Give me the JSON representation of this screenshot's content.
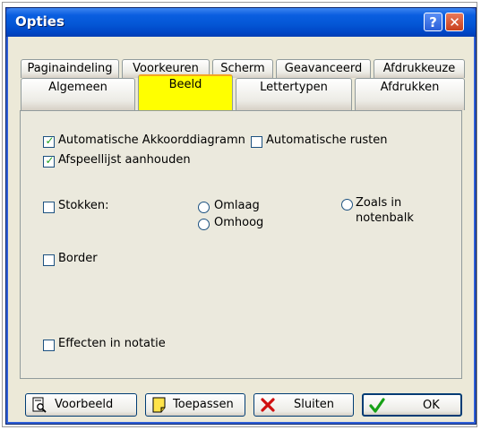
{
  "window": {
    "title": "Opties"
  },
  "titlebar": {
    "help_glyph": "?",
    "close_glyph": "✕"
  },
  "tabs": {
    "row1": [
      "Paginaindeling",
      "Voorkeuren",
      "Scherm",
      "Geavanceerd",
      "Afdrukkeuze"
    ],
    "row2": [
      "Algemeen",
      "Beeld",
      "Lettertypen",
      "Afdrukken"
    ],
    "active": "Beeld"
  },
  "options": {
    "auto_chord": {
      "label": "Automatische Akkoorddiagramn",
      "checked": true
    },
    "auto_rests": {
      "label": "Automatische rusten",
      "checked": false
    },
    "keep_playlist": {
      "label": "Afspeellijst aanhouden",
      "checked": true
    },
    "stems": {
      "label": "Stokken:",
      "checked": false
    },
    "stem_down": {
      "label": "Omlaag"
    },
    "stem_up": {
      "label": "Omhoog"
    },
    "stem_as_staff": {
      "label_line1": "Zoals in",
      "label_line2": "notenbalk"
    },
    "border": {
      "label": "Border",
      "checked": false
    },
    "effects": {
      "label": "Effecten in notatie",
      "checked": false
    }
  },
  "buttons": {
    "preview": "Voorbeeld",
    "apply": "Toepassen",
    "close": "Sluiten",
    "ok": "OK"
  },
  "colors": {
    "active_tab": "#ffff00",
    "titlebar": "#0a5ee0",
    "check": "#21a121"
  }
}
